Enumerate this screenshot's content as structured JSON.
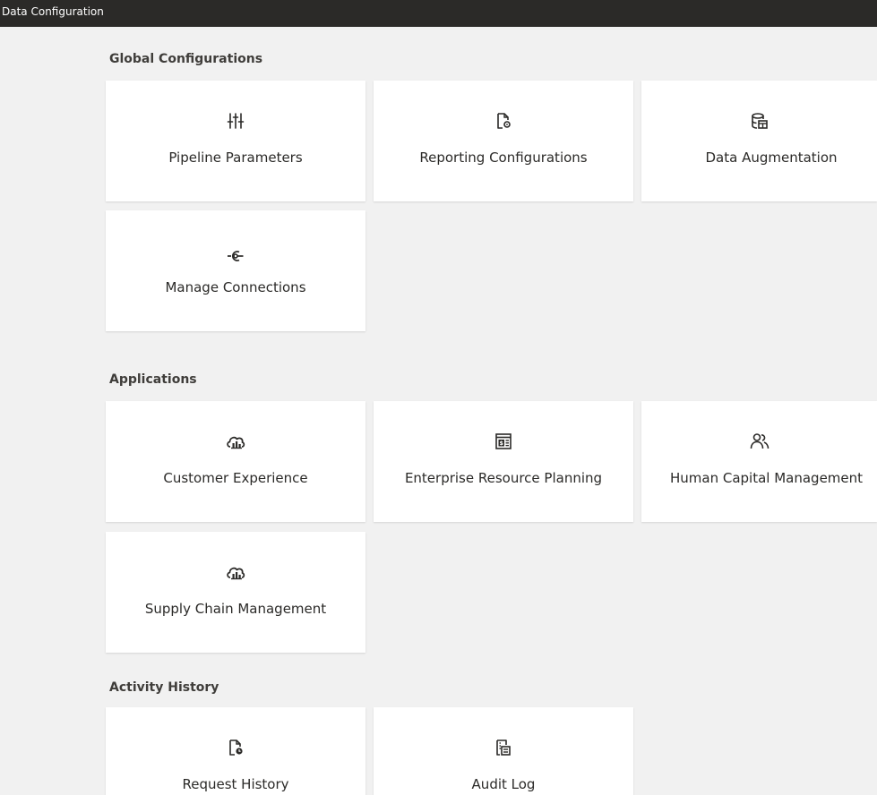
{
  "window": {
    "title": "Data Configuration"
  },
  "sections": [
    {
      "title": "Global Configurations",
      "cards": [
        {
          "label": "Pipeline Parameters",
          "icon": "sliders-icon"
        },
        {
          "label": "Reporting Configurations",
          "icon": "document-gear-icon"
        },
        {
          "label": "Data Augmentation",
          "icon": "database-table-icon"
        },
        {
          "label": "Manage Connections",
          "icon": "connection-icon"
        }
      ]
    },
    {
      "title": "Applications",
      "cards": [
        {
          "label": "Customer Experience",
          "icon": "cloud-chart-icon"
        },
        {
          "label": "Enterprise Resource Planning",
          "icon": "ledger-dollar-icon"
        },
        {
          "label": "Human Capital Management",
          "icon": "people-icon"
        },
        {
          "label": "Supply Chain Management",
          "icon": "cloud-chart-icon"
        }
      ]
    },
    {
      "title": "Activity History",
      "cards": [
        {
          "label": "Request History",
          "icon": "document-clock-icon"
        },
        {
          "label": "Audit Log",
          "icon": "audit-list-icon"
        }
      ]
    }
  ]
}
